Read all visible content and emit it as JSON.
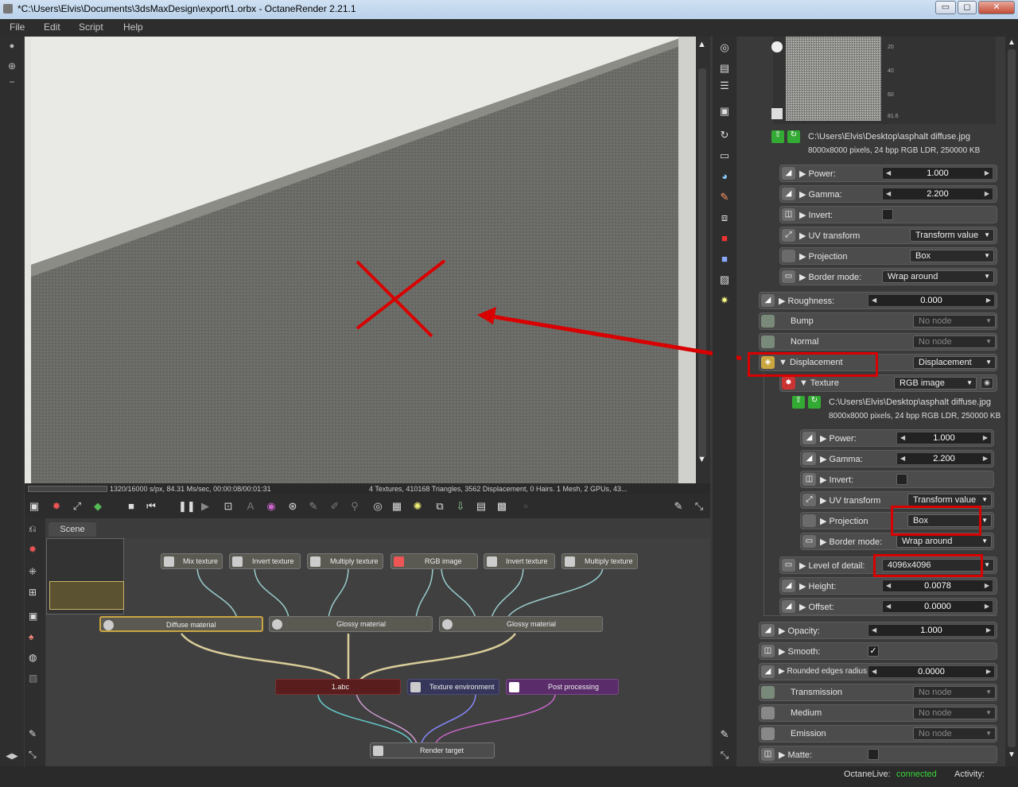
{
  "window": {
    "title": "*C:\\Users\\Elvis\\Documents\\3dsMaxDesign\\export\\1.orbx - OctaneRender 2.21.1",
    "min": "▭",
    "max": "◻",
    "close": "✕"
  },
  "menu": [
    "File",
    "Edit",
    "Script",
    "Help"
  ],
  "viewport": {
    "render_stats": "1320/16000 s/px, 84.31 Ms/sec, 00:00:08/00:01:31",
    "scene_stats": "4 Textures, 410168 Triangles, 3562 Displacement, 0 Hairs. 1 Mesh, 2 GPUs, 43..."
  },
  "graph": {
    "tab": "Scene",
    "nodes": {
      "mix": "Mix texture",
      "invert1": "Invert texture",
      "multiply1": "Multiply texture",
      "rgb": "RGB image",
      "invert2": "Invert texture",
      "multiply2": "Multiply texture",
      "diffuse": "Diffuse material",
      "glossy1": "Glossy material",
      "glossy2": "Glossy material",
      "abc": "1.abc",
      "texenv": "Texture environment",
      "post": "Post processing",
      "render": "Render target"
    }
  },
  "panel": {
    "preview_ticks": [
      "20",
      "40",
      "60",
      "81.6"
    ],
    "file1": {
      "path": "C:\\Users\\Elvis\\Desktop\\asphalt diffuse.jpg",
      "info": "8000x8000 pixels, 24 bpp RGB LDR, 250000 KB"
    },
    "rows1": {
      "power": "Power:",
      "power_val": "1.000",
      "gamma": "Gamma:",
      "gamma_val": "2.200",
      "invert": "Invert:",
      "uv": "UV transform",
      "uv_val": "Transform value",
      "proj": "Projection",
      "proj_val": "Box",
      "border": "Border mode:",
      "border_val": "Wrap around"
    },
    "roughness": "Roughness:",
    "roughness_val": "0.000",
    "bump": "Bump",
    "normal": "Normal",
    "no_node": "No node",
    "displacement": "Displacement",
    "displacement_val": "Displacement",
    "texture": "Texture",
    "texture_val": "RGB image",
    "file2": {
      "path": "C:\\Users\\Elvis\\Desktop\\asphalt diffuse.jpg",
      "info": "8000x8000 pixels, 24 bpp RGB LDR, 250000 KB"
    },
    "rows2": {
      "power": "Power:",
      "power_val": "1.000",
      "gamma": "Gamma:",
      "gamma_val": "2.200",
      "invert": "Invert:",
      "uv": "UV transform",
      "uv_val": "Transform value",
      "proj": "Projection",
      "proj_val": "Box",
      "border": "Border mode:",
      "border_val": "Wrap around"
    },
    "lod": "Level of detail:",
    "lod_val": "4096x4096",
    "height": "Height:",
    "height_val": "0.0078",
    "offset": "Offset:",
    "offset_val": "0.0000",
    "opacity": "Opacity:",
    "opacity_val": "1.000",
    "smooth": "Smooth:",
    "smooth_check": "✓",
    "rounded": "Rounded edges radius:",
    "rounded_val": "0.0000",
    "transmission": "Transmission",
    "medium": "Medium",
    "emission": "Emission",
    "matte": "Matte:"
  },
  "status": {
    "live_label": "OctaneLive:",
    "live_value": "connected",
    "activity": "Activity:",
    "live_color": "#39d639"
  },
  "annotation_color": "#d80000"
}
